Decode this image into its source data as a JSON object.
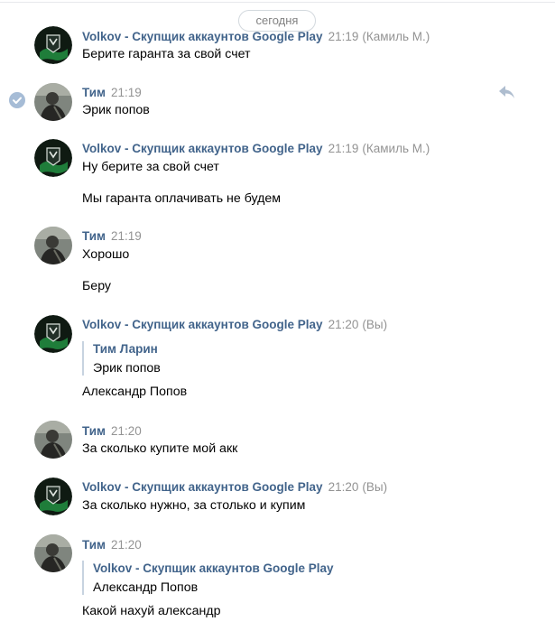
{
  "date_divider": "сегодня",
  "accent_color": "#42648b",
  "icons": {
    "read_status": "check-icon",
    "reply": "reply-icon",
    "avatar_volkov": "volkov-logo-avatar",
    "avatar_tim": "tim-photo-avatar"
  },
  "messages": [
    {
      "author": "Volkov - Скупщик аккаунтов Google Play",
      "time": "21:19",
      "note": "(Камиль М.)",
      "lines": [
        "Берите гаранта за свой счет"
      ]
    },
    {
      "author": "Тим",
      "time": "21:19",
      "lines": [
        "Эрик попов"
      ]
    },
    {
      "author": "Volkov - Скупщик аккаунтов Google Play",
      "time": "21:19",
      "note": "(Камиль М.)",
      "lines": [
        "Ну берите за свой счет",
        "Мы гаранта оплачивать не будем"
      ]
    },
    {
      "author": "Тим",
      "time": "21:19",
      "lines": [
        "Хорошо",
        "Беру"
      ]
    },
    {
      "author": "Volkov - Скупщик аккаунтов Google Play",
      "time": "21:20",
      "note": "(Вы)",
      "quote": {
        "author": "Тим Ларин",
        "text": "Эрик попов"
      },
      "lines": [
        "Александр Попов"
      ]
    },
    {
      "author": "Тим",
      "time": "21:20",
      "lines": [
        "За сколько купите мой акк"
      ]
    },
    {
      "author": "Volkov - Скупщик аккаунтов Google Play",
      "time": "21:20",
      "note": "(Вы)",
      "lines": [
        "За сколько нужно, за столько и купим"
      ]
    },
    {
      "author": "Тим",
      "time": "21:20",
      "quote": {
        "author": "Volkov - Скупщик аккаунтов Google Play",
        "text": "Александр Попов"
      },
      "lines": [
        "Какой нахуй александр"
      ]
    }
  ]
}
